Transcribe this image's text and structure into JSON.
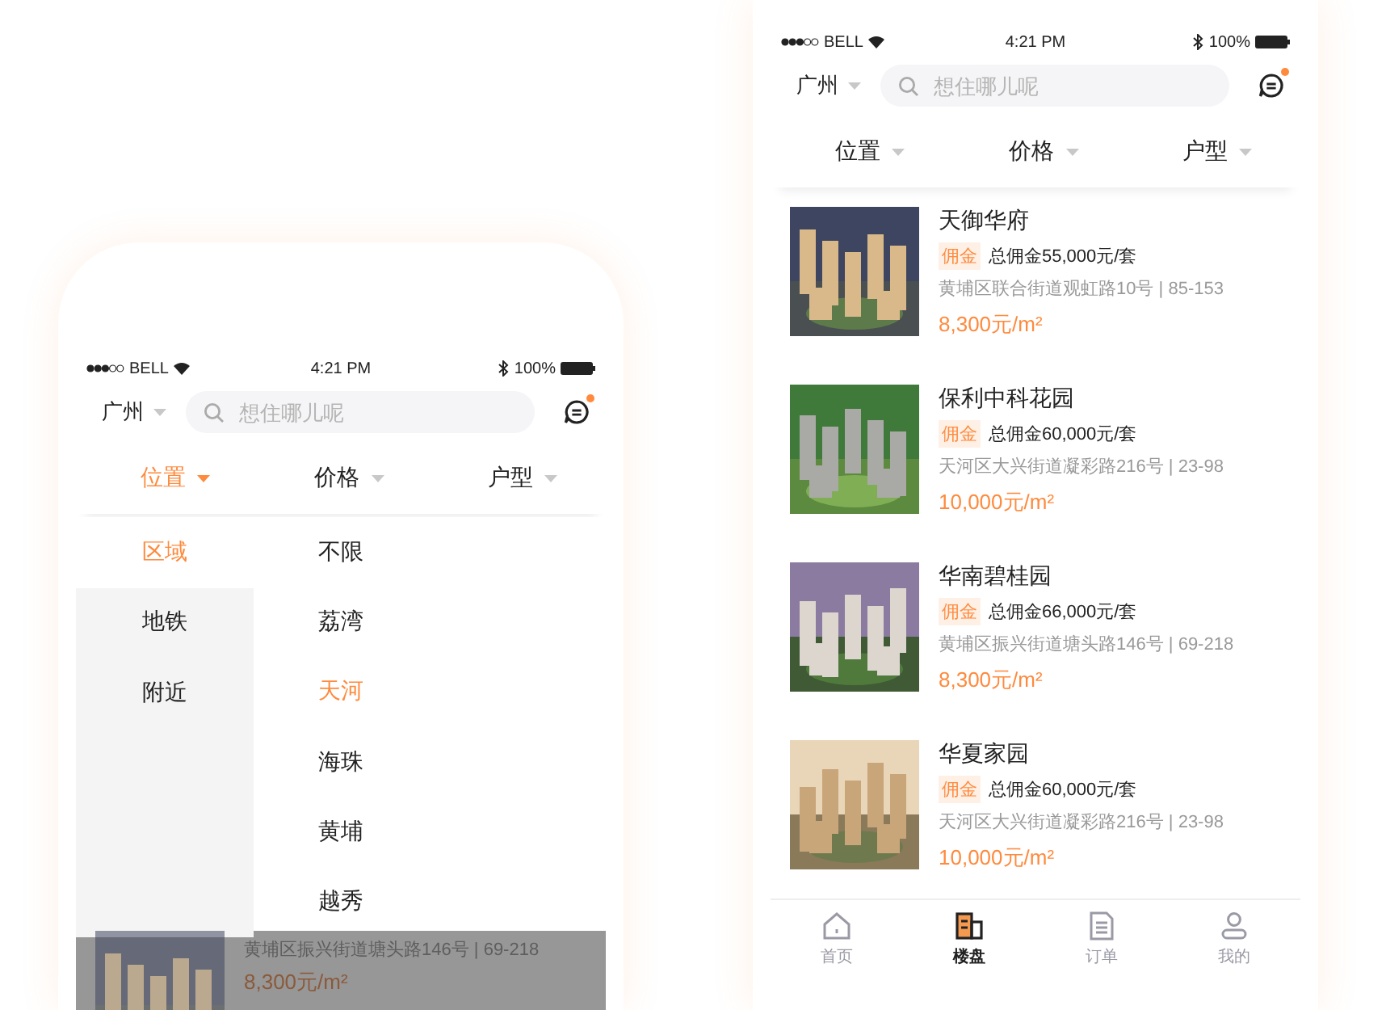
{
  "screens": [
    {
      "status_bar": {
        "carrier": "BELL",
        "time": "4:21 PM",
        "battery": "100%"
      },
      "city": "广州",
      "search": {
        "placeholder": "想住哪儿呢"
      },
      "messages_unread": true,
      "filters": [
        {
          "label": "位置",
          "selected": true
        },
        {
          "label": "价格",
          "selected": false
        },
        {
          "label": "户型",
          "selected": false
        }
      ],
      "dropdown": {
        "categories": [
          {
            "label": "区域",
            "selected": true
          },
          {
            "label": "地铁",
            "selected": false
          },
          {
            "label": "附近",
            "selected": false
          }
        ],
        "options": [
          {
            "label": "不限",
            "selected": false
          },
          {
            "label": "荔湾",
            "selected": false
          },
          {
            "label": "天河",
            "selected": true
          },
          {
            "label": "海珠",
            "selected": false
          },
          {
            "label": "黄埔",
            "selected": false
          },
          {
            "label": "越秀",
            "selected": false
          }
        ]
      },
      "listings": [
        {
          "address": "黄埔区振兴街道塘头路146号 | 69-218",
          "price": "8,300元/m²"
        }
      ]
    },
    {
      "status_bar": {
        "carrier": "BELL",
        "time": "4:21 PM",
        "battery": "100%"
      },
      "city": "广州",
      "search": {
        "placeholder": "想住哪儿呢"
      },
      "messages_unread": true,
      "filters": [
        {
          "label": "位置",
          "selected": false
        },
        {
          "label": "价格",
          "selected": false
        },
        {
          "label": "户型",
          "selected": false
        }
      ],
      "listings": [
        {
          "name": "天御华府",
          "tag": "佣金",
          "commission": "总佣金55,000元/套",
          "address": "黄埔区联合街道观虹路10号 | 85-153",
          "price": "8,300元/m²"
        },
        {
          "name": "保利中科花园",
          "tag": "佣金",
          "commission": "总佣金60,000元/套",
          "address": "天河区大兴街道凝彩路216号 | 23-98",
          "price": "10,000元/m²"
        },
        {
          "name": "华南碧桂园",
          "tag": "佣金",
          "commission": "总佣金66,000元/套",
          "address": "黄埔区振兴街道塘头路146号 | 69-218",
          "price": "8,300元/m²"
        },
        {
          "name": "华夏家园",
          "tag": "佣金",
          "commission": "总佣金60,000元/套",
          "address": "天河区大兴街道凝彩路216号 | 23-98",
          "price": "10,000元/m²"
        }
      ],
      "tab_bar": [
        {
          "label": "首页",
          "kind": "home",
          "selected": false
        },
        {
          "label": "楼盘",
          "kind": "building",
          "selected": true
        },
        {
          "label": "订单",
          "kind": "document",
          "selected": false
        },
        {
          "label": "我的",
          "kind": "person",
          "selected": false
        }
      ]
    }
  ]
}
